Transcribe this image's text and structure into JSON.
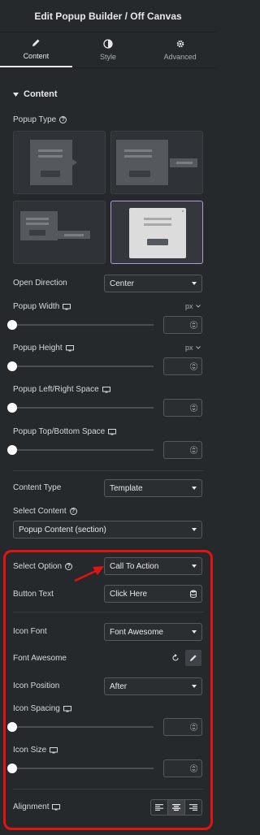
{
  "header": {
    "title": "Edit Popup Builder / Off Canvas"
  },
  "tabs": [
    {
      "label": "Content",
      "icon": "pencil-icon",
      "active": true
    },
    {
      "label": "Style",
      "icon": "half-circle-icon",
      "active": false
    },
    {
      "label": "Advanced",
      "icon": "gear-icon",
      "active": false
    }
  ],
  "section": {
    "title": "Content"
  },
  "popup_type": {
    "label": "Popup Type",
    "selected_index": 3
  },
  "open_direction": {
    "label": "Open Direction",
    "value": "Center"
  },
  "popup_width": {
    "label": "Popup Width",
    "unit": "px"
  },
  "popup_height": {
    "label": "Popup Height",
    "unit": "px"
  },
  "left_right_space": {
    "label": "Popup Left/Right Space"
  },
  "top_bottom_space": {
    "label": "Popup Top/Bottom Space"
  },
  "content_type": {
    "label": "Content Type",
    "value": "Template"
  },
  "select_content": {
    "label": "Select Content",
    "value": "Popup Content (section)"
  },
  "select_option": {
    "label": "Select Option",
    "value": "Call To Action"
  },
  "button_text": {
    "label": "Button Text",
    "value": "Click Here"
  },
  "icon_font": {
    "label": "Icon Font",
    "value": "Font Awesome"
  },
  "font_awesome": {
    "label": "Font Awesome"
  },
  "icon_position": {
    "label": "Icon Position",
    "value": "After"
  },
  "icon_spacing": {
    "label": "Icon Spacing"
  },
  "icon_size": {
    "label": "Icon Size"
  },
  "alignment": {
    "label": "Alignment",
    "options": [
      "left",
      "center",
      "right"
    ],
    "selected": "center"
  },
  "colors": {
    "background": "#26292c",
    "accent_selected": "#b19bd3",
    "highlight": "#e51212"
  }
}
